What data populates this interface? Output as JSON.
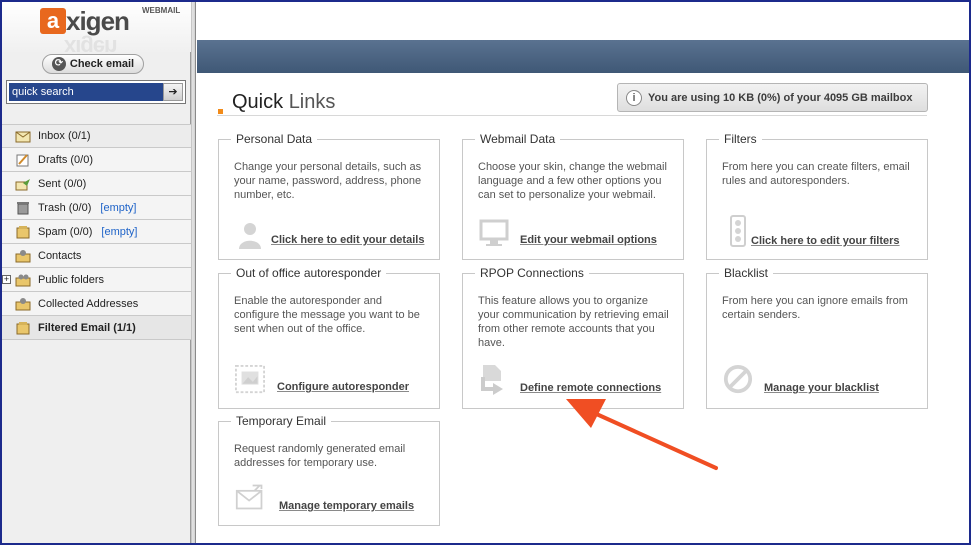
{
  "app": {
    "logo_text": "xigen",
    "logo_letter": "a",
    "logo_sub": "WEBMAIL",
    "check_email_label": "Check email"
  },
  "search": {
    "placeholder": "quick search",
    "go_symbol": "➔"
  },
  "folders": [
    {
      "label": "Inbox (0/1)",
      "icon": "inbox-icon",
      "empty": ""
    },
    {
      "label": "Drafts (0/0)",
      "icon": "drafts-icon",
      "empty": ""
    },
    {
      "label": "Sent (0/0)",
      "icon": "sent-icon",
      "empty": ""
    },
    {
      "label": "Trash (0/0)",
      "icon": "trash-icon",
      "empty": "[empty]"
    },
    {
      "label": "Spam (0/0)",
      "icon": "spam-icon",
      "empty": "[empty]"
    },
    {
      "label": "Contacts",
      "icon": "contacts-icon",
      "empty": ""
    },
    {
      "label": "Public folders",
      "icon": "public-folders-icon",
      "empty": ""
    },
    {
      "label": "Collected Addresses",
      "icon": "collected-addresses-icon",
      "empty": ""
    },
    {
      "label": "Filtered Email (1/1)",
      "icon": "filtered-email-icon",
      "empty": ""
    }
  ],
  "quick_links": {
    "title_bold": "Quick",
    "title_light": "Links",
    "usage_text": "You are using 10 KB (0%) of your 4095 GB mailbox"
  },
  "cards": {
    "personal": {
      "title": "Personal Data",
      "desc": "Change your personal details, such as your name, password, address, phone number, etc.",
      "link": "Click here to edit your details"
    },
    "webmail": {
      "title": "Webmail Data",
      "desc": "Choose your skin, change the webmail language and a few other options you can set to personalize your webmail.",
      "link": "Edit your webmail options"
    },
    "filters": {
      "title": "Filters",
      "desc": "From here you can create filters, email rules and autoresponders.",
      "link": "Click here to edit your filters"
    },
    "autoresponder": {
      "title": "Out of office autoresponder",
      "desc": "Enable the autoresponder and configure the message you want to be sent when out of the office.",
      "link": "Configure autoresponder"
    },
    "rpop": {
      "title": "RPOP Connections",
      "desc": "This feature allows you to organize your communication by retrieving email from other remote accounts that you have.",
      "link": "Define remote connections"
    },
    "blacklist": {
      "title": "Blacklist",
      "desc": "From here you can ignore emails from certain senders.",
      "link": "Manage your blacklist"
    },
    "temporary": {
      "title": "Temporary Email",
      "desc": "Request randomly generated email addresses for temporary use.",
      "link": "Manage temporary emails"
    }
  },
  "colors": {
    "accent_orange": "#f28b1a",
    "annotation_arrow": "#f04e23",
    "topbar": "#4a6382",
    "search_bg": "#26468c"
  }
}
